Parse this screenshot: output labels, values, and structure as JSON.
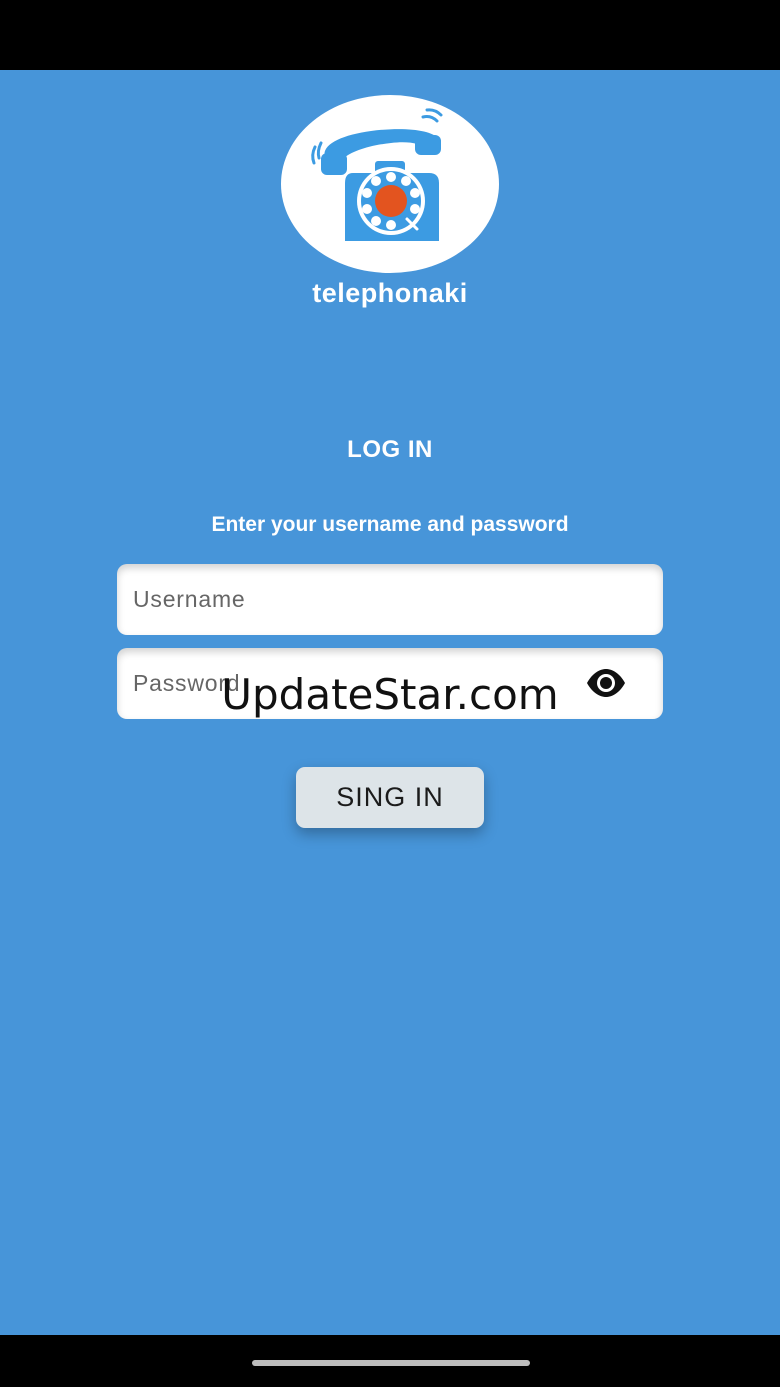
{
  "app": {
    "name": "telephonaki"
  },
  "logo": {
    "icon": "rotary-telephone-icon"
  },
  "login": {
    "title": "LOG IN",
    "subtitle": "Enter your username and password",
    "username_placeholder": "Username",
    "username_value": "",
    "password_placeholder": "Password",
    "password_value": "",
    "password_toggle_icon": "eye-icon",
    "submit_label": "SING IN"
  },
  "watermark": {
    "text": "UpdateStar.com"
  },
  "colors": {
    "background": "#4795D9",
    "button": "#DDE4E8",
    "phone_blue": "#3C9BE2",
    "dial_center": "#E3541F"
  }
}
